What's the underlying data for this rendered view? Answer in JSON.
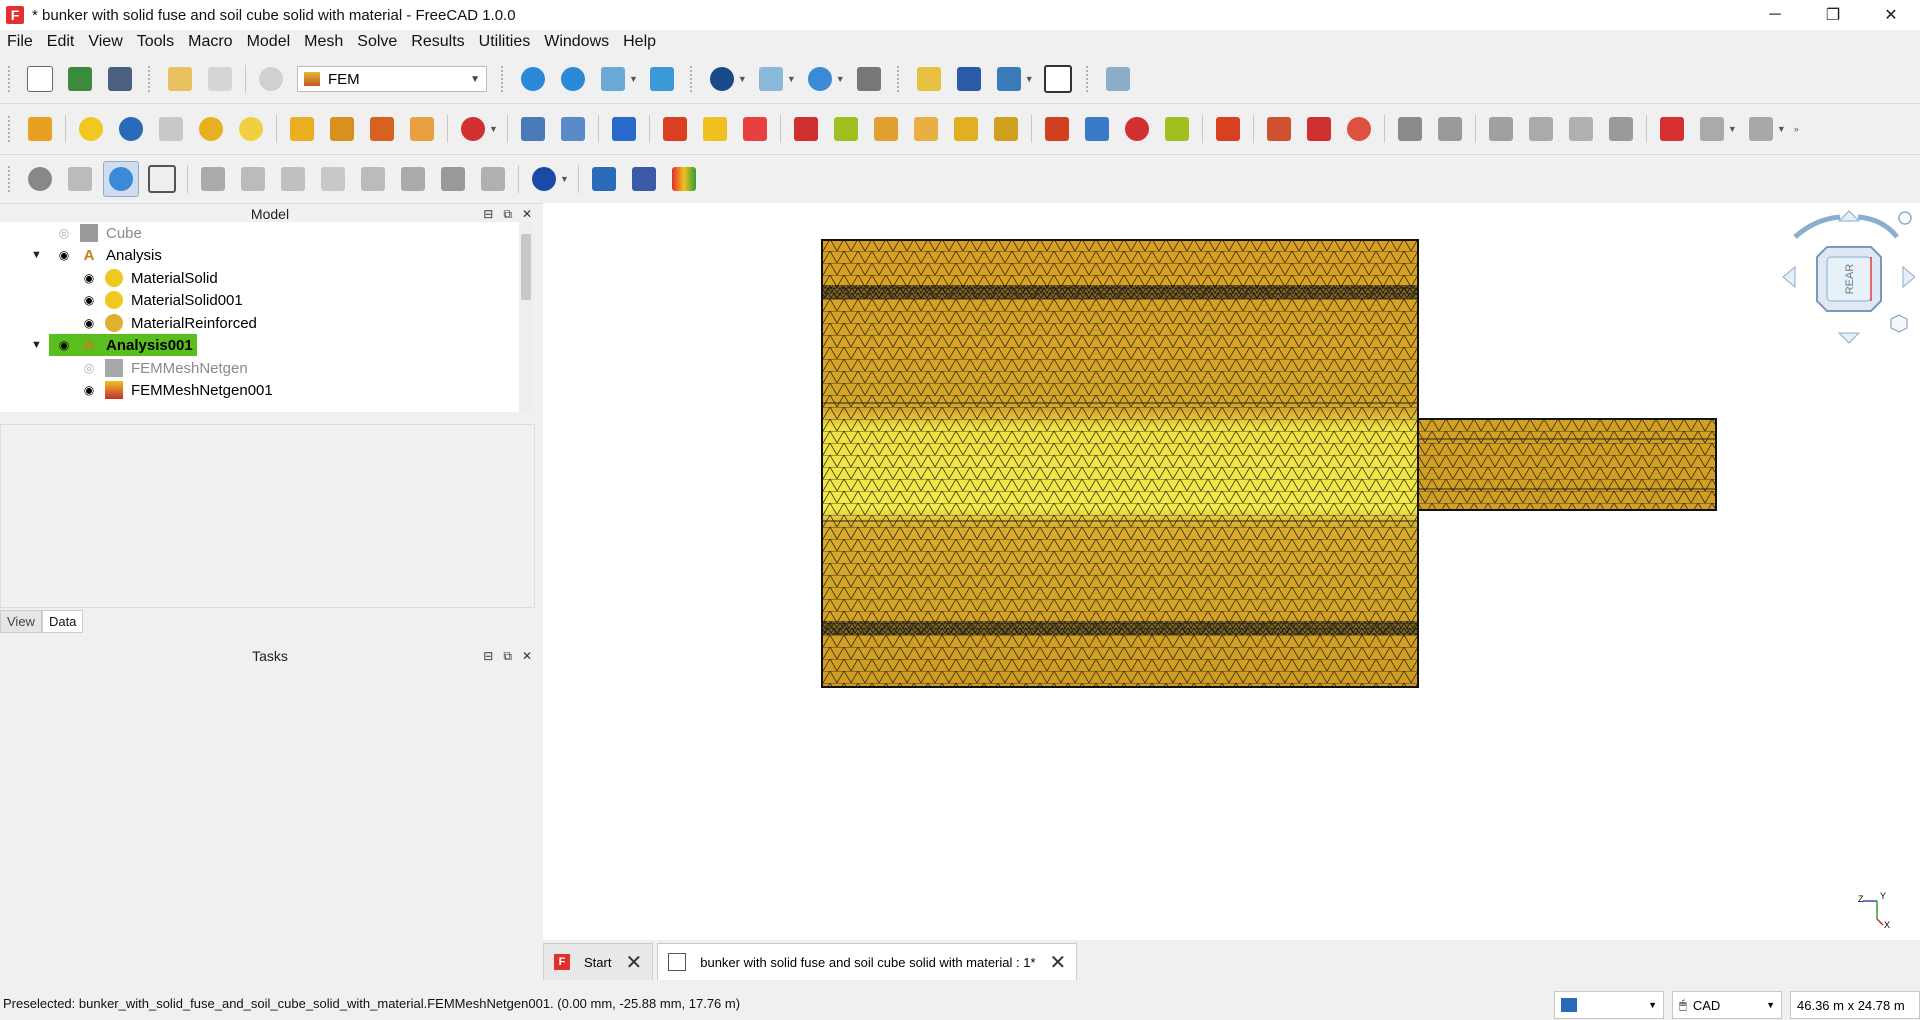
{
  "window": {
    "title": "* bunker with solid fuse and soil cube solid with material - FreeCAD 1.0.0",
    "app_icon_letter": "F",
    "minimize": "─",
    "restore": "❐",
    "close": "✕"
  },
  "menu": [
    "File",
    "Edit",
    "View",
    "Tools",
    "Macro",
    "Model",
    "Mesh",
    "Solve",
    "Results",
    "Utilities",
    "Windows",
    "Help"
  ],
  "workbench": {
    "label": "FEM"
  },
  "model_panel": {
    "title": "Model",
    "tree": {
      "cube": "Cube",
      "analysis": "Analysis",
      "material_solid": "MaterialSolid",
      "material_solid001": "MaterialSolid001",
      "material_reinforced": "MaterialReinforced",
      "analysis001": "Analysis001",
      "fem_mesh_netgen": "FEMMeshNetgen",
      "fem_mesh_netgen001": "FEMMeshNetgen001"
    },
    "tabs": {
      "view": "View",
      "data": "Data"
    }
  },
  "tasks_panel": {
    "title": "Tasks"
  },
  "navcube": {
    "face_label": "REAR"
  },
  "axis": {
    "z": "Z",
    "y": "Y",
    "x": "X"
  },
  "doc_tabs": {
    "start": "Start",
    "document": "bunker with solid fuse and soil cube solid with material : 1*"
  },
  "status": {
    "text": "Preselected: bunker_with_solid_fuse_and_soil_cube_solid_with_material.FEMMeshNetgen001. (0.00 mm, -25.88 mm, 17.76 m)",
    "nav_style": "CAD",
    "dimensions": "46.36 m x 24.78 m"
  },
  "colors": {
    "mesh_dark": "#d4a020",
    "mesh_light": "#f2e040",
    "mesh_edge": "#1a1a1a",
    "selection": "#5abf1e"
  }
}
